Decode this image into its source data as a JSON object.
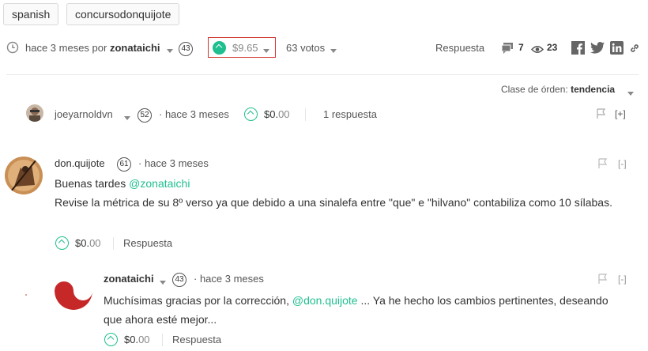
{
  "tags": [
    "spanish",
    "concursodonquijote"
  ],
  "post_meta": {
    "time_text": "hace 3 meses por",
    "author": "zonataichi",
    "author_rep": "43",
    "payout_dollars": "$9.",
    "payout_cents": "65",
    "votes": "63 votos",
    "reply_label": "Respuesta",
    "comments_count": "7",
    "views_count": "23"
  },
  "sort": {
    "label": "Clase de órden:",
    "value": "tendencia"
  },
  "comments": [
    {
      "author": "joeyarnoldvn",
      "rep": "52",
      "time": "· hace 3 meses",
      "payout_dollars": "$0.",
      "payout_cents": "00",
      "replies": "1 respuesta",
      "collapse": "[+]"
    },
    {
      "author": "don.quijote",
      "rep": "61",
      "time": "· hace 3 meses",
      "line1_text": "Buenas tardes ",
      "line1_mention": "@zonataichi",
      "body": "Revise la métrica de su 8º verso ya que debido a una sinalefa entre \"que\" e \"hilvano\" contabiliza como 10 sílabas.",
      "payout_dollars": "$0.",
      "payout_cents": "00",
      "reply_label": "Respuesta",
      "collapse": "[-]"
    },
    {
      "author": "zonataichi",
      "rep": "43",
      "time": "· hace 3 meses",
      "body_start": "Muchísimas gracias por la corrección, ",
      "body_mention": "@don.quijote",
      "body_end": " ... Ya he hecho los cambios pertinentes, deseando que ahora esté mejor...",
      "payout_dollars": "$0.",
      "payout_cents": "00",
      "reply_label": "Respuesta",
      "collapse": "[-]"
    }
  ],
  "colors": {
    "accent": "#1fbf8f",
    "highlight_border": "#d0342c"
  }
}
